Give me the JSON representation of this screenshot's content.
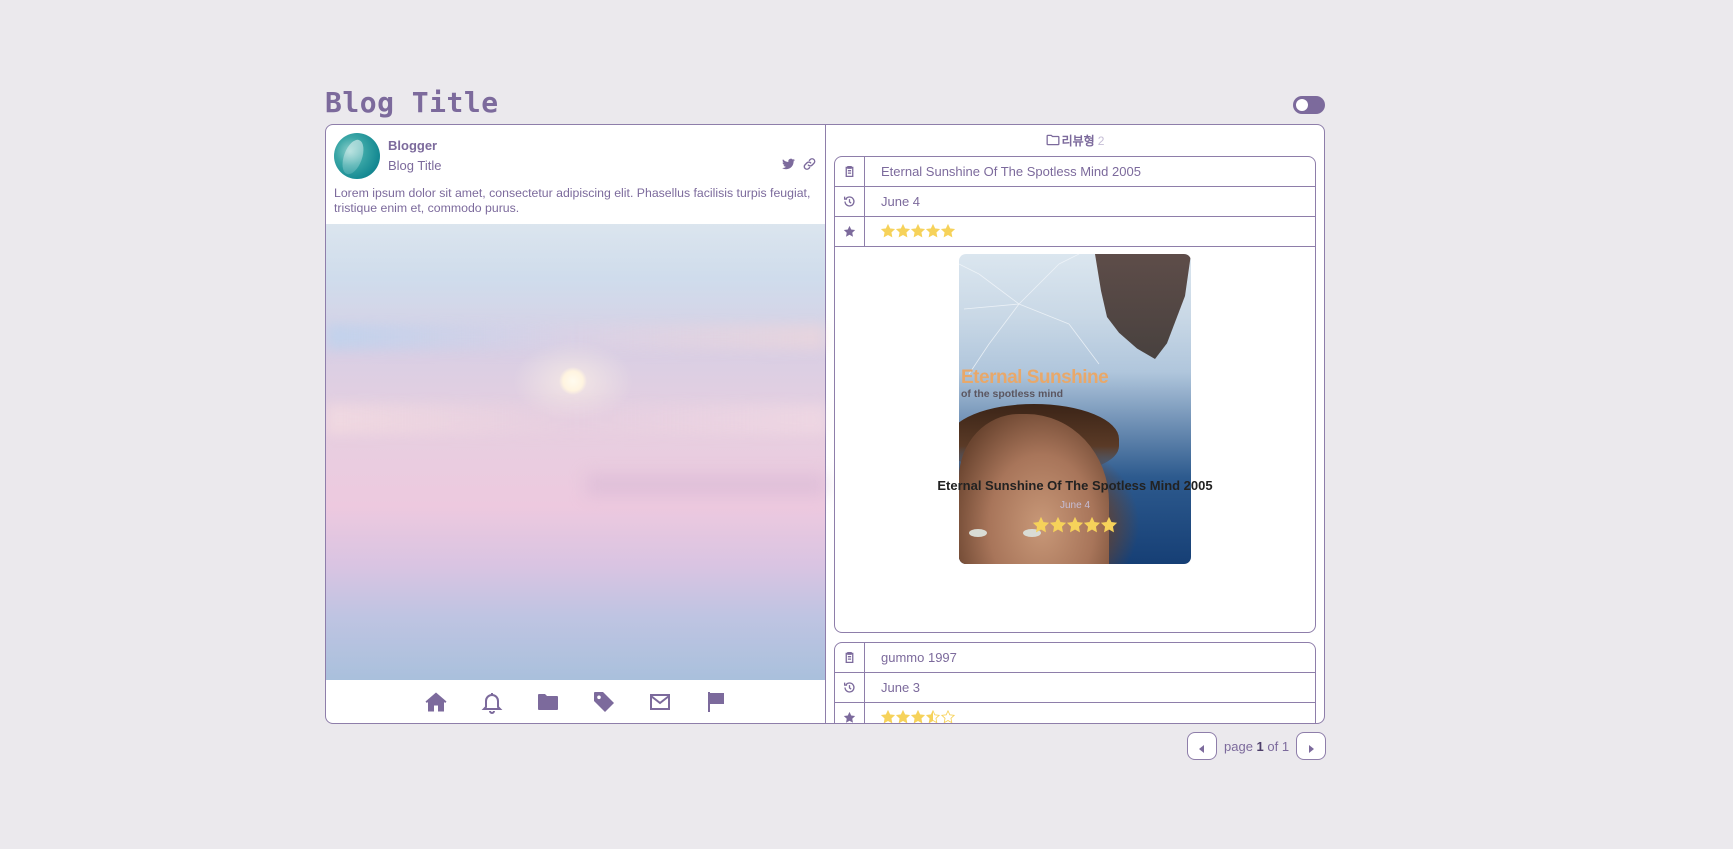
{
  "header": {
    "blog_title": "Blog Title",
    "theme_toggle": "off"
  },
  "profile": {
    "name": "Blogger",
    "subtitle": "Blog Title",
    "bio": "Lorem ipsum dolor sit amet, consectetur adipiscing elit. Phasellus facilisis turpis feugiat, tristique enim et, commodo purus.",
    "social_icons": [
      "twitter-icon",
      "link-icon"
    ]
  },
  "bottom_nav": [
    "home-icon",
    "bell-icon",
    "folder-icon",
    "tag-icon",
    "mail-icon",
    "flag-icon"
  ],
  "category": {
    "name": "리뷰형",
    "count": "2"
  },
  "posts": [
    {
      "title": "Eternal Sunshine Of The Spotless Mind 2005",
      "date": "June 4",
      "rating": 5,
      "poster_title": "Eternal Sunshine",
      "poster_subtitle": "of the spotless mind"
    },
    {
      "title": "gummo 1997",
      "date": "June 3",
      "rating": 3.5
    }
  ],
  "pagination": {
    "prefix": "page",
    "current": "1",
    "sep": "of",
    "total": "1"
  },
  "colors": {
    "accent": "#7c6a9c",
    "background": "#ebe9ed",
    "star": "#f6d25a",
    "border": "#8e7eaa"
  }
}
